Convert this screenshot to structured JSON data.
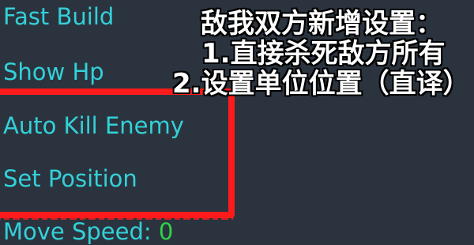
{
  "menu": {
    "fast_build": "Fast Build",
    "show_hp": "Show Hp",
    "auto_kill_enemy": "Auto Kill Enemy",
    "set_position": "Set Position",
    "move_speed_label": "Move Speed:",
    "move_speed_value": "0"
  },
  "annotation": {
    "title": "敌我双方新增设置：",
    "line1": "1.直接杀死敌方所有",
    "line2": "2.设置单位位置（直译）"
  },
  "colors": {
    "background": "#2b343e",
    "menu_text": "#33d1d9",
    "speed_value": "#2fd44a",
    "highlight": "#ff1b1b",
    "annotation_text": "#ffffff"
  }
}
